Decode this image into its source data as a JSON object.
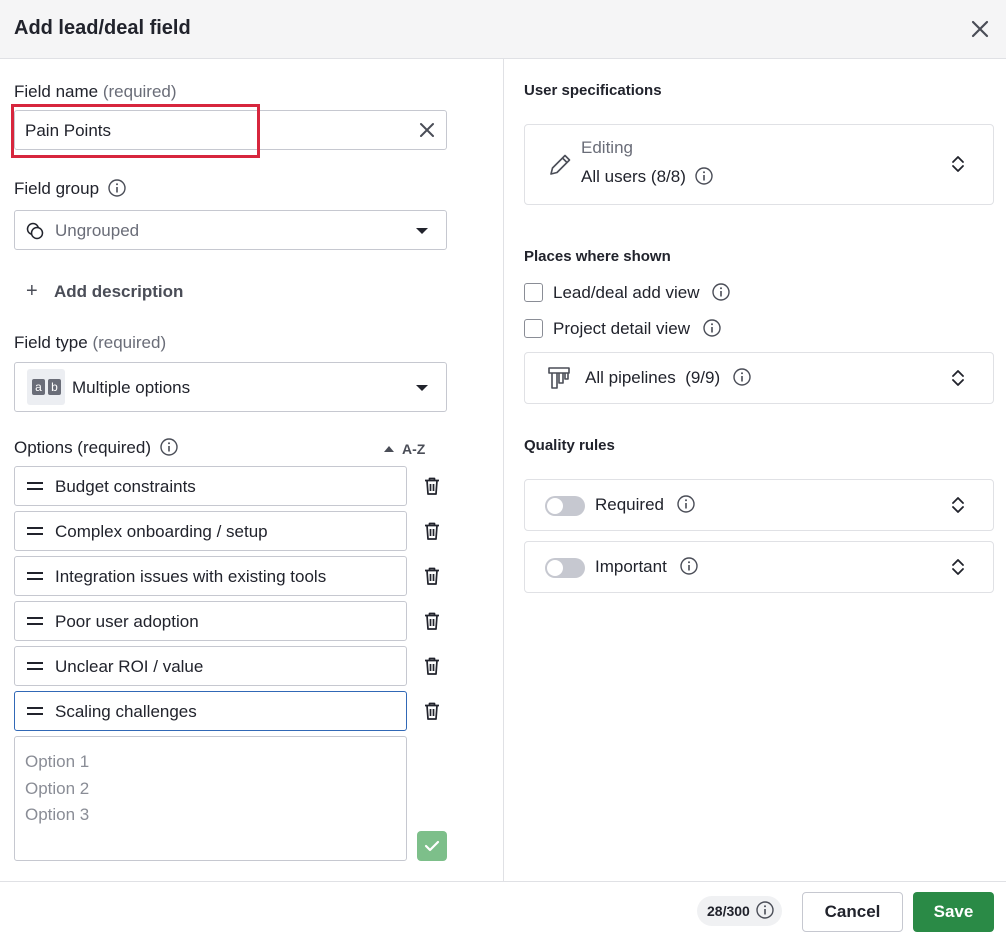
{
  "dialog": {
    "title": "Add lead/deal field"
  },
  "field_name": {
    "label": "Field name",
    "req": "(required)",
    "value": "Pain Points"
  },
  "field_group": {
    "label": "Field group",
    "value": "Ungrouped"
  },
  "add_description": "Add description",
  "field_type": {
    "label": "Field type",
    "req": "(required)",
    "value": "Multiple options",
    "icon_letters": [
      "a",
      "b"
    ]
  },
  "options": {
    "label": "Options (required)",
    "sort_label": "A-Z",
    "items": [
      "Budget constraints",
      "Complex onboarding / setup",
      "Integration issues with existing tools",
      "Poor user adoption",
      "Unclear ROI / value",
      "Scaling challenges"
    ],
    "placeholder": [
      "Option 1",
      "Option 2",
      "Option 3"
    ]
  },
  "user_specs": {
    "title": "User specifications",
    "mode": "Editing",
    "value": "All users (8/8)"
  },
  "places": {
    "title": "Places where shown",
    "items": [
      "Lead/deal add view",
      "Project detail view"
    ],
    "pipelines": "All pipelines",
    "pipelines_count": "(9/9)"
  },
  "quality": {
    "title": "Quality rules",
    "rules": [
      "Required",
      "Important"
    ]
  },
  "footer": {
    "counter": "28/300",
    "cancel": "Cancel",
    "save": "Save"
  },
  "colors": {
    "primary": "#2a8a46",
    "highlight": "#d7263d",
    "focus": "#3168b6"
  }
}
